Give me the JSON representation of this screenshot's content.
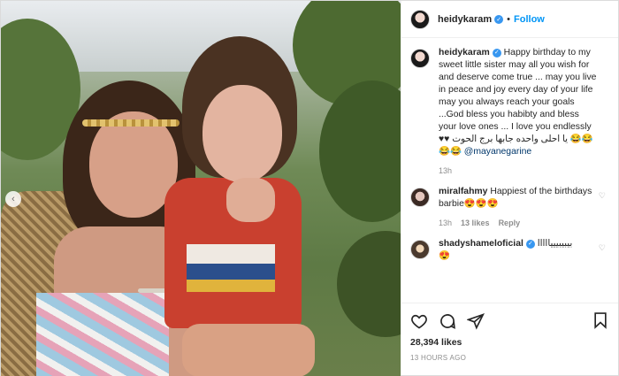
{
  "header": {
    "username": "heidykaram",
    "follow_label": "Follow",
    "separator": "•"
  },
  "caption": {
    "username": "heidykaram",
    "text": "Happy birthday to my sweet little sister may all you wish for and deserve come true ... may you live in peace and joy every day of your life may you always reach your goals ...God bless you habibty and bless your love ones ... I love you endlessly ♥♥ يا احلى واحده جابها برج الحوت 😂😂 😂😂",
    "mention": "@mayanegarine",
    "time": "13h"
  },
  "comments": [
    {
      "username": "miralfahmy",
      "text": "Happiest of the birthdays barbie😍😍😍",
      "time": "13h",
      "likes": "13 likes",
      "reply_label": "Reply"
    },
    {
      "username": "shadyshameloficial",
      "text": "بيبيبيييااااا",
      "emoji": "😍"
    }
  ],
  "footer": {
    "likes": "28,394 likes",
    "timestamp": "13 HOURS AGO"
  },
  "icons": {
    "like": "heart-icon",
    "comment": "comment-icon",
    "share": "share-icon",
    "save": "bookmark-icon",
    "carousel": "chevron-left-icon",
    "verified": "verified-badge-icon"
  },
  "colors": {
    "accent": "#0095f6",
    "verified": "#3897f0",
    "muted": "#8e8e8e",
    "text": "#262626"
  }
}
